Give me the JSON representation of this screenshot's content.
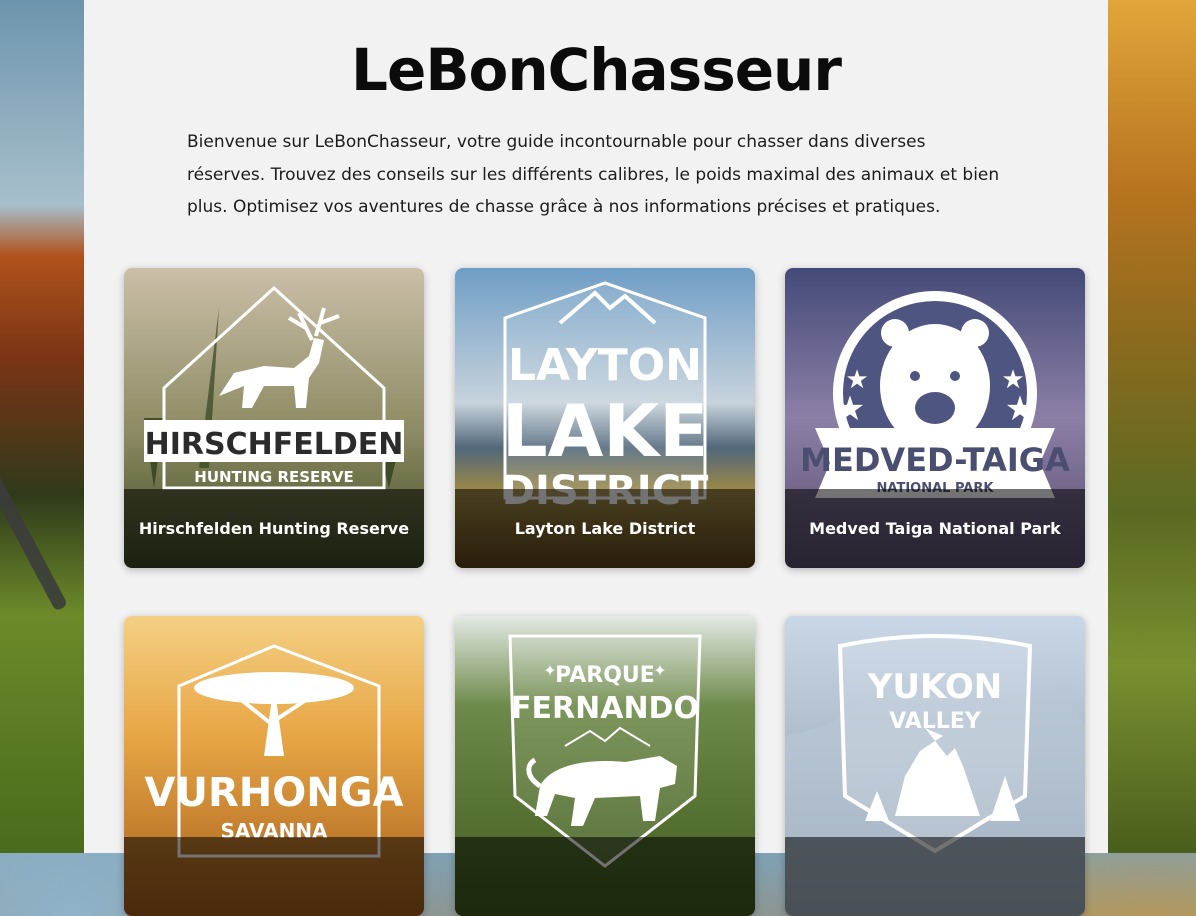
{
  "site": {
    "title": "LeBonChasseur",
    "intro": "Bienvenue sur LeBonChasseur, votre guide incontournable pour chasser dans diverses réserves. Trouvez des conseils sur les différents calibres, le poids maximal des animaux et bien plus. Optimisez vos aventures de chasse grâce à nos informations précises et pratiques."
  },
  "reserves": [
    {
      "caption": "Hirschfelden Hunting Reserve",
      "logo_line1": "HIRSCHFELDEN",
      "logo_line2": "HUNTING RESERVE",
      "icon": "deer-icon",
      "bg_top": "#c2b9a6",
      "bg_bottom": "#4f5a30"
    },
    {
      "caption": "Layton Lake District",
      "logo_line1": "LAYTON",
      "logo_line2": "LAKE",
      "logo_line3": "DISTRICT",
      "icon": "mountain-icon",
      "bg_top": "#6f9dc4",
      "bg_bottom": "#7a5a25"
    },
    {
      "caption": "Medved Taiga National Park",
      "logo_line1": "MEDVED-TAIGA",
      "logo_line2": "NATIONAL PARK",
      "icon": "bear-icon",
      "bg_top": "#4c4f7a",
      "bg_bottom": "#b6a9c6"
    },
    {
      "caption": "",
      "logo_line1": "VURHONGA",
      "logo_line2": "SAVANNA",
      "icon": "acacia-tree-icon",
      "bg_top": "#f2c46b",
      "bg_bottom": "#b86c20"
    },
    {
      "caption": "",
      "logo_line1": "PARQUE",
      "logo_line2": "FERNANDO",
      "icon": "jaguar-icon",
      "bg_top": "#dfe6e2",
      "bg_bottom": "#4f6a24"
    },
    {
      "caption": "",
      "logo_line1": "YUKON",
      "logo_line2": "VALLEY",
      "icon": "wolf-icon",
      "bg_top": "#c7d5e3",
      "bg_bottom": "#7d8fa3"
    }
  ]
}
